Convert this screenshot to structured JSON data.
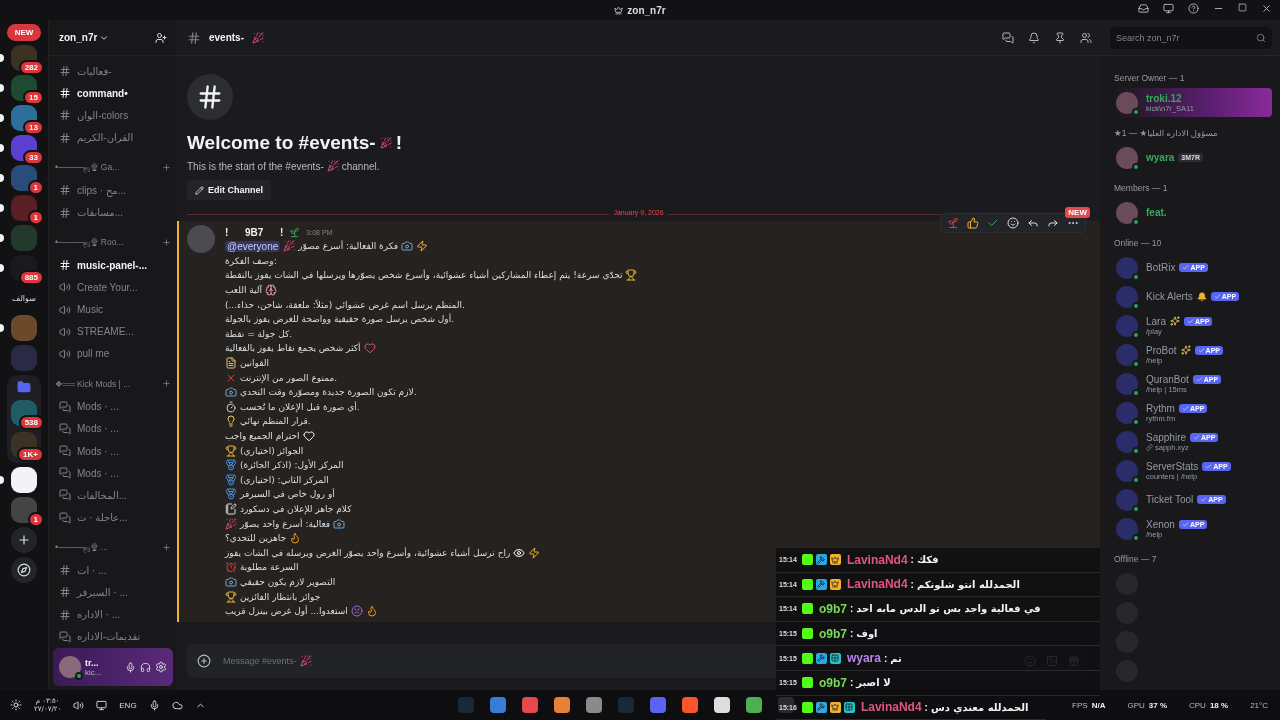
{
  "titlebar": {
    "title": "zon_n7r"
  },
  "servers": [
    {
      "kind": "new",
      "label": "NEW"
    },
    {
      "kind": "avatar",
      "badge": "282",
      "unread": true
    },
    {
      "kind": "avatar",
      "badge": "15",
      "unread": true
    },
    {
      "kind": "avatar",
      "badge": "13",
      "unread": true
    },
    {
      "kind": "avatar",
      "badge": "33",
      "unread": true
    },
    {
      "kind": "avatar",
      "badge": "1",
      "unread": true
    },
    {
      "kind": "avatar",
      "badge": "1",
      "unread": true
    },
    {
      "kind": "avatar",
      "unread": true
    },
    {
      "kind": "avatar",
      "badge": "885",
      "unread": true
    },
    {
      "kind": "text",
      "label": "سوالف",
      "unread": false
    },
    {
      "kind": "avatar",
      "unread": true
    },
    {
      "kind": "avatar",
      "unread": false
    },
    {
      "kind": "folder",
      "unread": false,
      "children": [
        {
          "kind": "avatar",
          "badge": "538",
          "unread": false
        },
        {
          "kind": "avatar",
          "badge": "1K+",
          "unread": false
        }
      ]
    },
    {
      "kind": "avatar",
      "unread": true
    },
    {
      "kind": "avatar",
      "badge": "1",
      "unread": false
    },
    {
      "kind": "add"
    },
    {
      "kind": "discover"
    }
  ],
  "server": {
    "name": "zon_n7r"
  },
  "channels": [
    {
      "kind": "text",
      "name": "فعاليات-",
      "unread": false
    },
    {
      "kind": "text",
      "name": "command•",
      "unread": true
    },
    {
      "kind": "text",
      "name": "الوان-colors",
      "unread": false
    },
    {
      "kind": "text",
      "name": "القران-الكريم",
      "unread": false
    },
    {
      "kind": "category",
      "name": "•———ஜ۩ Ga..."
    },
    {
      "kind": "text",
      "name": "clips · مح...",
      "unread": false
    },
    {
      "kind": "text",
      "name": "مسابقات...",
      "unread": false
    },
    {
      "kind": "category",
      "name": "•———ஜ۩ Roo..."
    },
    {
      "kind": "text",
      "name": "music-panel-...",
      "unread": true
    },
    {
      "kind": "voice",
      "name": "Create Your...",
      "unread": false
    },
    {
      "kind": "voice",
      "name": "Music",
      "unread": false
    },
    {
      "kind": "voice",
      "name": "STREAME...",
      "unread": false
    },
    {
      "kind": "voice",
      "name": "pull me",
      "unread": false
    },
    {
      "kind": "category",
      "name": "❖══ Kick Mods | ..."
    },
    {
      "kind": "thread",
      "name": "Mods · ...",
      "unread": false
    },
    {
      "kind": "thread",
      "name": "Mods · ...",
      "unread": false
    },
    {
      "kind": "thread",
      "name": "Mods · ...",
      "unread": false
    },
    {
      "kind": "thread",
      "name": "Mods · ...",
      "unread": false
    },
    {
      "kind": "thread",
      "name": "المخالفات...",
      "unread": false
    },
    {
      "kind": "thread",
      "name": "عاجلة · ت...",
      "unread": false
    },
    {
      "kind": "category",
      "name": "•———ஜ۩ ..."
    },
    {
      "kind": "text",
      "name": "ات · ...",
      "unread": false
    },
    {
      "kind": "text",
      "name": "السيرفر · ...",
      "unread": false
    },
    {
      "kind": "text",
      "name": "الاداره · ...",
      "unread": false
    },
    {
      "kind": "thread",
      "name": "تقديمات-الاداره",
      "unread": false
    }
  ],
  "user_panel": {
    "name": "tr...",
    "status": "kic..."
  },
  "channel_header": {
    "name": "events-",
    "search": {
      "placeholder": "Search zon_n7r"
    }
  },
  "welcome": {
    "title": "Welcome to #events-",
    "title_end": "!",
    "text": "This is the start of the #events-",
    "text_end": "channel.",
    "button": "Edit Channel"
  },
  "divider": {
    "date": "January 9, 2026",
    "tag": "NEW"
  },
  "message": {
    "author": "!      9B7      !",
    "time": "3:08 PM",
    "mentioned": true,
    "lines": [
      {
        "mention": "@everyone",
        "icons_before": [
          {
            "kind": "party"
          }
        ],
        "text": "فكرة الفعالية: أسرع مصوّر",
        "icons_after": [
          {
            "kind": "camera"
          },
          {
            "kind": "zap"
          }
        ]
      },
      {
        "text": "وصف الفكرة:"
      },
      {
        "text": "تحدّي سرعة! يتم إعطاء المشاركين أشياء عشوائية، وأسرع شخص يصوّرها ويرسلها في الشات يفوز بالنقطة",
        "icons_after": [
          {
            "kind": "trophy"
          }
        ]
      },
      {
        "text": "آلية اللعب",
        "icons_after": [
          {
            "kind": "brain"
          }
        ]
      },
      {
        "text": "المنظم يرسل اسم غرض عشوائي (مثلاً: ملعقة، شاحن، حذاء...)."
      },
      {
        "text": "أول شخص يرسل صورة حقيقية وواضحة للغرض يفوز بالجولة."
      },
      {
        "text": "كل جولة = نقطة."
      },
      {
        "text": "أكثر شخص يجمع نقاط يفوز بالفعالية",
        "icons_after": [
          {
            "kind": "hearts"
          }
        ]
      },
      {
        "icons_before": [
          {
            "kind": "scroll"
          }
        ],
        "text": "القوانين"
      },
      {
        "icons_before": [
          {
            "kind": "cross"
          }
        ],
        "text": "ممنوع الصور من الإنترنت."
      },
      {
        "icons_before": [
          {
            "kind": "camera"
          }
        ],
        "text": "لازم تكون الصورة جديدة ومصوّرة وقت التحدي."
      },
      {
        "icons_before": [
          {
            "kind": "timer"
          }
        ],
        "text": "أي صورة قبل الإعلان ما تُحسب."
      },
      {
        "icons_before": [
          {
            "kind": "bulb"
          }
        ],
        "text": "قرار المنظم نهائي."
      },
      {
        "text": "احترام الجميع واجب",
        "icons_after": [
          {
            "kind": "heart"
          }
        ]
      },
      {
        "icons_before": [
          {
            "kind": "trophy"
          }
        ],
        "text": "الجوائز (اختياري)"
      },
      {
        "icons_before": [
          {
            "kind": "medal"
          }
        ],
        "text": "المركز الأول: (اذكر الجائزة)"
      },
      {
        "icons_before": [
          {
            "kind": "medal"
          }
        ],
        "text": "المركز الثاني: (اختياري)"
      },
      {
        "icons_before": [
          {
            "kind": "medal"
          }
        ],
        "text": "أو رول خاص في السيرفر"
      },
      {
        "icons_before": [
          {
            "kind": "memo"
          }
        ],
        "text": "كلام جاهز للإعلان في دسكورد"
      },
      {
        "icons_before": [
          {
            "kind": "party"
          }
        ],
        "text": "فعالية: أسرع واحد يصوّر",
        "icons_after": [
          {
            "kind": "camera"
          }
        ]
      },
      {
        "text": "جاهزين للتحدي؟",
        "icons_after": [
          {
            "kind": "fire"
          }
        ]
      },
      {
        "text": "راح نرسل أشياء عشوائية، وأسرع واحد يصوّر الغرض ويرسله في الشات يفوز",
        "icons_after": [
          {
            "kind": "eyes"
          },
          {
            "kind": "zap"
          }
        ]
      },
      {
        "icons_before": [
          {
            "kind": "clock"
          }
        ],
        "text": "السرعة مطلوبة"
      },
      {
        "icons_before": [
          {
            "kind": "camera"
          }
        ],
        "text": "التصوير لازم يكون حقيقي"
      },
      {
        "icons_before": [
          {
            "kind": "trophy"
          }
        ],
        "text": "جوائز بانتظار الفائزين"
      },
      {
        "text": "استعدوا... أول غرض بينزل قريب",
        "icons_after": [
          {
            "kind": "devil"
          },
          {
            "kind": "fire"
          }
        ]
      }
    ]
  },
  "composer": {
    "placeholder": "Message #events-"
  },
  "members": [
    {
      "title": "Server Owner — 1",
      "rows": [
        {
          "kind": "member",
          "name": "troki.12",
          "sub": "kick\\n7r_SA11",
          "color": "#3ba55d",
          "banner": true
        }
      ]
    },
    {
      "title": "★مسؤول الاداره العليا★ — 1",
      "rows": [
        {
          "kind": "member",
          "name": "wyara",
          "tag": "3M7R",
          "color": "#3ba55d",
          "banner": false
        }
      ]
    },
    {
      "title": "Members — 1",
      "rows": [
        {
          "kind": "member",
          "name": "feat.",
          "color": "#3ba55d",
          "banner": false
        }
      ]
    },
    {
      "title": "Online — 10",
      "rows": [
        {
          "kind": "bot",
          "name": "BotRix",
          "app": "APP"
        },
        {
          "kind": "bot",
          "name": "Kick Alerts",
          "decor": {
            "kind": "bell"
          },
          "app": "APP"
        },
        {
          "kind": "bot",
          "name": "Lara",
          "decor": {
            "kind": "sparkles"
          },
          "app": "APP",
          "sub": "/play"
        },
        {
          "kind": "bot",
          "name": "ProBot",
          "decor": {
            "kind": "sparkles"
          },
          "app": "APP",
          "sub": "/help"
        },
        {
          "kind": "bot",
          "name": "QuranBot",
          "app": "APP",
          "sub": "/help | 15ms"
        },
        {
          "kind": "bot",
          "name": "Rythm",
          "app": "APP",
          "sub": "rythm.fm"
        },
        {
          "kind": "bot",
          "name": "Sapphire",
          "app": "APP",
          "sub": "sapph.xyz",
          "link": true
        },
        {
          "kind": "bot",
          "name": "ServerStats",
          "app": "APP",
          "sub": "counters | /help"
        },
        {
          "kind": "bot",
          "name": "Ticket Tool",
          "app": "APP"
        },
        {
          "kind": "bot",
          "name": "Xenon",
          "app": "APP",
          "sub": "/help"
        }
      ]
    },
    {
      "title": "Offline — 7",
      "rows": [
        {
          "kind": "offline"
        },
        {
          "kind": "offline"
        },
        {
          "kind": "offline"
        },
        {
          "kind": "offline"
        }
      ]
    }
  ],
  "overlay": [
    {
      "time": "15:14",
      "badges": [
        {
          "kind": "kick"
        },
        {
          "kind": "mod"
        },
        {
          "kind": "crown"
        }
      ],
      "name": "LavinaNd4",
      "color": "#e0557f",
      "sep": ":",
      "text": "فكك"
    },
    {
      "time": "15:14",
      "badges": [
        {
          "kind": "kick"
        },
        {
          "kind": "mod"
        },
        {
          "kind": "crown"
        }
      ],
      "name": "LavinaNd4",
      "color": "#e0557f",
      "sep": ":",
      "text": "الحمدلله انتو شلونكم"
    },
    {
      "time": "15:14",
      "badges": [
        {
          "kind": "kick"
        }
      ],
      "name": "o9b7",
      "color": "#7ed957",
      "sep": ":",
      "text": "في فعالية واجد بس تو الدس مابه احد"
    },
    {
      "time": "15:15",
      "badges": [
        {
          "kind": "kick"
        }
      ],
      "name": "o9b7",
      "color": "#7ed957",
      "sep": ":",
      "text": "اوف"
    },
    {
      "time": "15:15",
      "badges": [
        {
          "kind": "kick"
        },
        {
          "kind": "mod"
        },
        {
          "kind": "sub"
        }
      ],
      "name": "wyara",
      "color": "#b884e8",
      "sep": ":",
      "text": "تم"
    },
    {
      "time": "15:15",
      "badges": [
        {
          "kind": "kick"
        }
      ],
      "name": "o9b7",
      "color": "#7ed957",
      "sep": ":",
      "text": "لا اصبر"
    },
    {
      "time": "15:16",
      "badges": [
        {
          "kind": "kick"
        },
        {
          "kind": "mod"
        },
        {
          "kind": "crown"
        },
        {
          "kind": "sub"
        }
      ],
      "name": "LavinaNd4",
      "color": "#e0557f",
      "sep": ":",
      "text": "الحمدلله معندي دس"
    }
  ],
  "taskbar": {
    "time": "٠٣:٥٠ م",
    "date": "٢٧/٠٧/٢٠",
    "lang": "ENG",
    "fps": {
      "label": "FPS",
      "value": "N/A"
    },
    "gpu": {
      "label": "GPU",
      "value": "37 %"
    },
    "cpu": {
      "label": "CPU",
      "value": "18 %"
    },
    "weather": "21°C"
  }
}
